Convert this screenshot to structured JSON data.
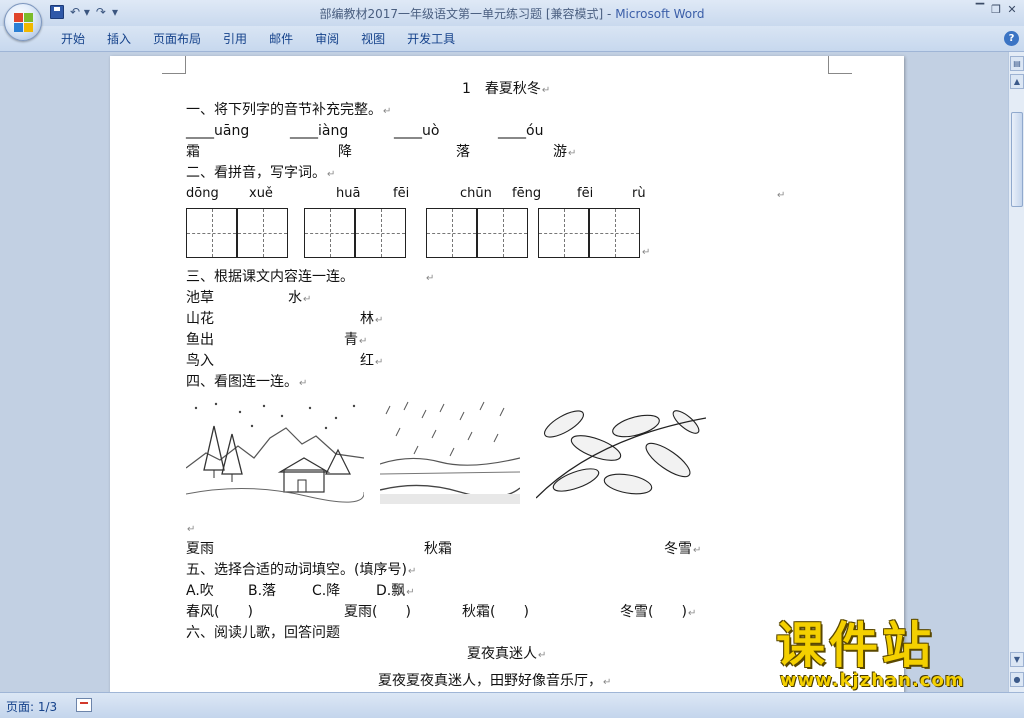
{
  "window": {
    "doc_title": "部编教材2017一年级语文第一单元练习题 [兼容模式]",
    "separator": " - ",
    "app_name": "Microsoft Word",
    "minimize": "▔",
    "restore": "❐",
    "close": "✕"
  },
  "ribbon": {
    "tabs": [
      "开始",
      "插入",
      "页面布局",
      "引用",
      "邮件",
      "审阅",
      "视图",
      "开发工具"
    ],
    "help": "?"
  },
  "qat": {
    "undo": "↶ ▾",
    "redo": "↷",
    "more": "▾"
  },
  "doc": {
    "title": "1　春夏秋冬",
    "s1": "一、将下列字的音节补充完整。",
    "s1_blanks": [
      "____uāng",
      "____iàng",
      "____uò",
      "____óu"
    ],
    "s1_chars": [
      "霜",
      "降",
      "落",
      "游"
    ],
    "s2": "二、看拼音，写字词。",
    "s2_pinyin": [
      "dōng",
      "xuě",
      "huā",
      "fēi",
      "chūn",
      "fēng",
      "fēi",
      "rù"
    ],
    "s3": "三、根据课文内容连一连。",
    "s3_left": [
      "池草",
      "山花",
      "鱼出",
      "鸟入"
    ],
    "s3_right": [
      "水",
      "林",
      "青",
      "红"
    ],
    "s4": "四、看图连一连。",
    "s4_words": [
      "夏雨",
      "秋霜",
      "冬雪"
    ],
    "s5": "五、选择合适的动词填空。(填序号)",
    "s5_options": [
      "A.吹",
      "B.落",
      "C.降",
      "D.飘"
    ],
    "s5_fill": [
      "春风(　　)",
      "夏雨(　　)",
      "秋霜(　　)",
      "冬雪(　　)"
    ],
    "s6": "六、阅读儿歌，回答问题",
    "poem_title": "夏夜真迷人",
    "poem_line1": "夏夜夏夜真迷人，田野好像音乐厅，",
    "para_mark": "↵"
  },
  "status": {
    "page": "页面: 1/3"
  },
  "watermark": {
    "cn": "课件站",
    "url": "www.kjzhan.com"
  },
  "colors": {
    "accent": "#15428b",
    "app_name": "#3a5ea8",
    "watermark": "#f4d000"
  },
  "icons": [
    "office-button-icon",
    "save-icon",
    "undo-icon",
    "redo-icon",
    "help-icon",
    "scroll-up-icon",
    "scroll-down-icon",
    "page-icon"
  ]
}
